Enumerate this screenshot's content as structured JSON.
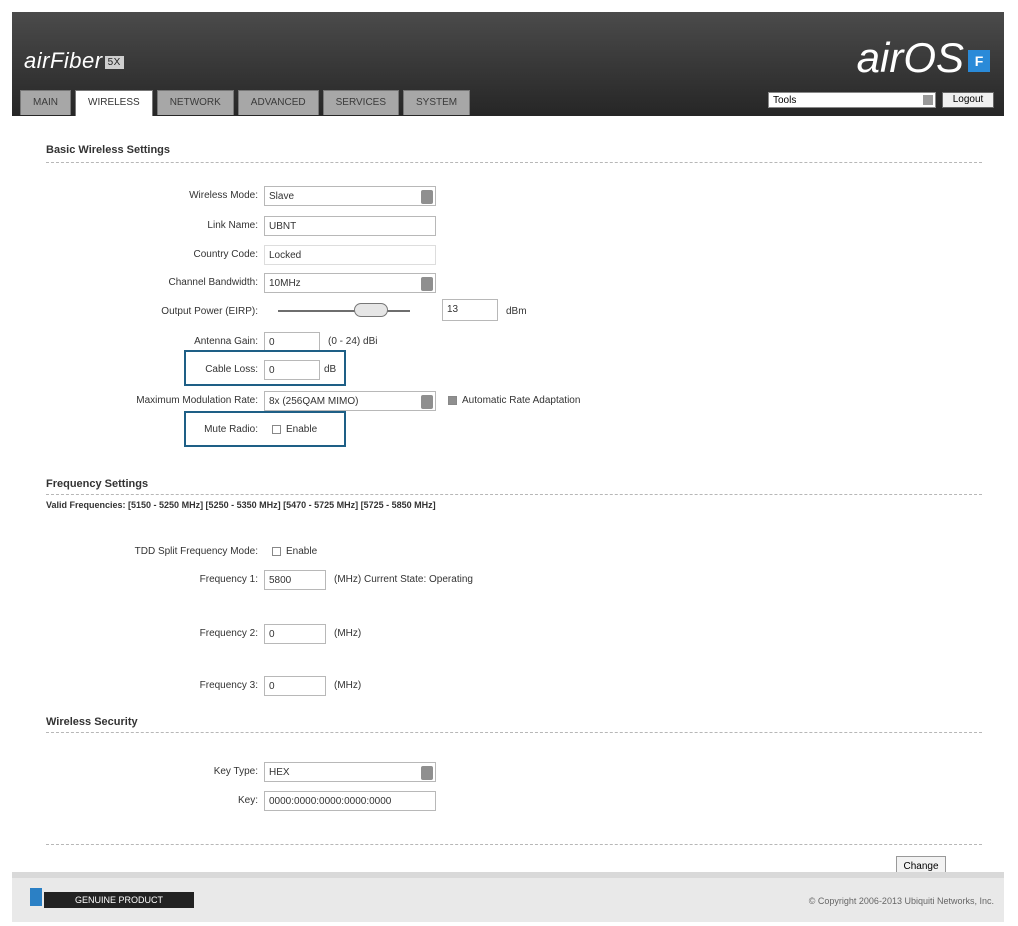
{
  "header": {
    "brand": "airFiber",
    "brand_badge": "5X",
    "airos_title": "airOS",
    "airos_icon_letter": "F",
    "tabs": [
      "MAIN",
      "WIRELESS",
      "NETWORK",
      "ADVANCED",
      "SERVICES",
      "SYSTEM"
    ],
    "active_tab": "WIRELESS",
    "tools_label": "Tools",
    "logout_label": "Logout"
  },
  "basic": {
    "title": "Basic Wireless Settings",
    "wireless_mode_label": "Wireless Mode:",
    "wireless_mode_value": "Slave",
    "link_name_label": "Link Name:",
    "link_name_value": "UBNT",
    "country_code_label": "Country Code:",
    "country_code_value": "Locked",
    "channel_bw_label": "Channel Bandwidth:",
    "channel_bw_value": "10MHz",
    "output_power_label": "Output Power (EIRP):",
    "output_power_value": "13",
    "output_power_unit": "dBm",
    "antenna_gain_label": "Antenna Gain:",
    "antenna_gain_value": "0",
    "antenna_gain_range": "(0 - 24) dBi",
    "cable_loss_label": "Cable Loss:",
    "cable_loss_value": "0",
    "cable_loss_unit": "dB",
    "max_mod_label": "Maximum Modulation Rate:",
    "max_mod_value": "8x (256QAM MIMO)",
    "auto_rate_label": "Automatic Rate Adaptation",
    "auto_rate_checked": true,
    "mute_radio_label": "Mute Radio:",
    "mute_radio_option": "Enable"
  },
  "frequency": {
    "title": "Frequency Settings",
    "valid_frequencies": "Valid Frequencies: [5150 - 5250 MHz] [5250 - 5350 MHz] [5470 - 5725 MHz] [5725 - 5850 MHz]",
    "tdd_label": "TDD Split Frequency Mode:",
    "tdd_option": "Enable",
    "freq1_label": "Frequency 1:",
    "freq1_value": "5800",
    "freq1_unit": "(MHz) Current State: Operating",
    "freq2_label": "Frequency 2:",
    "freq2_value": "0",
    "freq2_unit": "(MHz)",
    "freq3_label": "Frequency 3:",
    "freq3_value": "0",
    "freq3_unit": "(MHz)"
  },
  "security": {
    "title": "Wireless Security",
    "key_type_label": "Key Type:",
    "key_type_value": "HEX",
    "key_label": "Key:",
    "key_value": "0000:0000:0000:0000:0000"
  },
  "actions": {
    "change_label": "Change"
  },
  "footer": {
    "badge_text": "GENUINE PRODUCT",
    "copyright": "© Copyright 2006-2013 Ubiquiti Networks, Inc."
  },
  "colors": {
    "highlight": "#1e5f86",
    "header_bg": "#333333",
    "icon_blue": "#2a8ad8"
  }
}
